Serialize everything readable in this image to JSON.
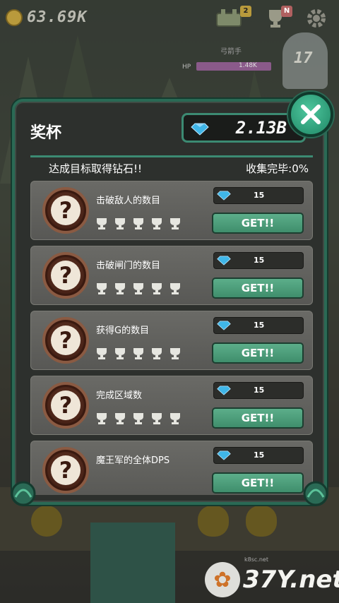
{
  "hud": {
    "gold": "63.69K",
    "boss_name": "弓箭手",
    "hp_label": "HP",
    "hp_value": "1.48K",
    "level": "17",
    "quest_badge": "2",
    "trophy_badge": "N"
  },
  "panel": {
    "title": "奖杯",
    "gems": "2.13B",
    "subtitle": "达成目标取得钻石!!",
    "collect_status": "收集完毕:0%"
  },
  "achievements": [
    {
      "label": "击破敌人的数目",
      "reward": "15",
      "button": "GET!!"
    },
    {
      "label": "击破闸门的数目",
      "reward": "15",
      "button": "GET!!"
    },
    {
      "label": "获得G的数目",
      "reward": "15",
      "button": "GET!!"
    },
    {
      "label": "完成区域数",
      "reward": "15",
      "button": "GET!!"
    },
    {
      "label": "魔王军的全体DPS",
      "reward": "15",
      "button": "GET!!"
    }
  ],
  "watermark": {
    "text": "37Y.net",
    "sub": "k8sc.net"
  },
  "colors": {
    "accent": "#2a6a55",
    "button": "#4e9e7c",
    "gem": "#3fb6e8"
  }
}
